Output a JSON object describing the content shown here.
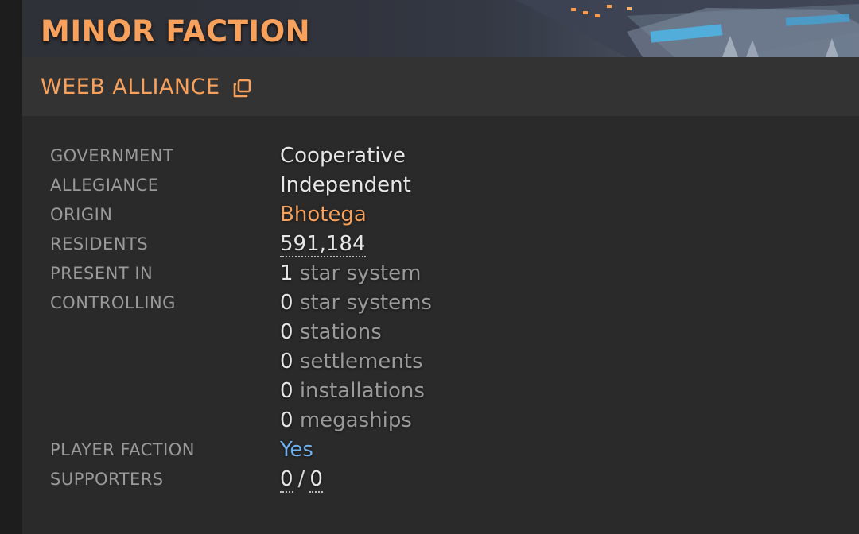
{
  "header": {
    "title": "MINOR FACTION"
  },
  "faction": {
    "name": "WEEB ALLIANCE",
    "link_icon": "external-link-icon"
  },
  "details": {
    "government": {
      "label": "GOVERNMENT",
      "value": "Cooperative"
    },
    "allegiance": {
      "label": "ALLEGIANCE",
      "value": "Independent"
    },
    "origin": {
      "label": "ORIGIN",
      "value": "Bhotega"
    },
    "residents": {
      "label": "RESIDENTS",
      "value": "591,184"
    },
    "present_in": {
      "label": "PRESENT IN",
      "count": "1",
      "unit": "star system"
    },
    "controlling": {
      "label": "CONTROLLING",
      "items": [
        {
          "count": "0",
          "unit": "star systems"
        },
        {
          "count": "0",
          "unit": "stations"
        },
        {
          "count": "0",
          "unit": "settlements"
        },
        {
          "count": "0",
          "unit": "installations"
        },
        {
          "count": "0",
          "unit": "megaships"
        }
      ]
    },
    "player_faction": {
      "label": "PLAYER FACTION",
      "value": "Yes"
    },
    "supporters": {
      "label": "SUPPORTERS",
      "current": "0",
      "separator": "/",
      "total": "0"
    }
  },
  "colors": {
    "accent_orange": "#f7a15c",
    "link_blue": "#6fb0ee",
    "label_gray": "#9a9a9a",
    "value_white": "#e6e6e6"
  }
}
